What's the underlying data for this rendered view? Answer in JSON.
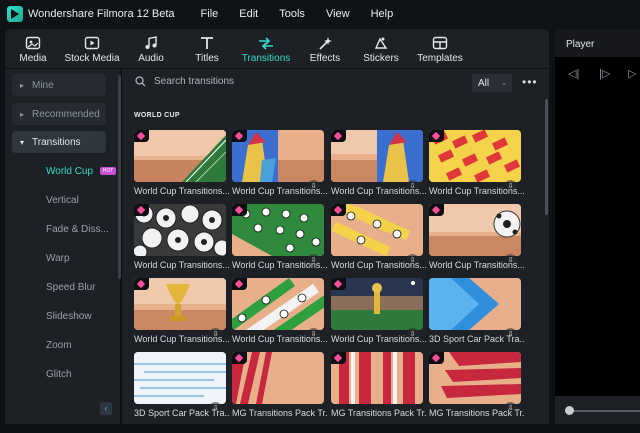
{
  "app": {
    "title": "Wondershare Filmora 12 Beta"
  },
  "menu": [
    "File",
    "Edit",
    "Tools",
    "View",
    "Help"
  ],
  "toolbar": [
    {
      "label": "Media",
      "icon": "media-icon"
    },
    {
      "label": "Stock Media",
      "icon": "stock-media-icon"
    },
    {
      "label": "Audio",
      "icon": "music-note-icon"
    },
    {
      "label": "Titles",
      "icon": "titles-icon"
    },
    {
      "label": "Transitions",
      "icon": "transitions-icon",
      "active": true
    },
    {
      "label": "Effects",
      "icon": "effects-icon"
    },
    {
      "label": "Stickers",
      "icon": "stickers-icon"
    },
    {
      "label": "Templates",
      "icon": "templates-icon"
    }
  ],
  "player": {
    "title": "Player"
  },
  "sidebar": {
    "groups": [
      {
        "label": "Mine",
        "expanded": false
      },
      {
        "label": "Recommended",
        "expanded": false
      },
      {
        "label": "Transitions",
        "expanded": true
      }
    ],
    "subitems": [
      "World Cup",
      "Vertical",
      "Fade & Diss...",
      "Warp",
      "Speed Blur",
      "Slideshow",
      "Zoom",
      "Glitch"
    ],
    "active_sub": "World Cup",
    "hot_badge": "HOT"
  },
  "search": {
    "placeholder": "Search transitions"
  },
  "filter": {
    "value": "All"
  },
  "section_title": "WORLD CUP",
  "items": [
    "World Cup Transitions...",
    "World Cup Transitions...",
    "World Cup Transitions...",
    "World Cup Transitions...",
    "World Cup Transitions...",
    "World Cup Transitions...",
    "World Cup Transitions...",
    "World Cup Transitions...",
    "World Cup Transitions...",
    "World Cup Transitions...",
    "World Cup Transitions...",
    "3D Sport Car Pack Tra...",
    "3D Sport Car Pack Tra...",
    "MG Transitions Pack Tr...",
    "MG Transitions Pack Tr...",
    "MG Transitions Pack Tr..."
  ],
  "colors": {
    "accent": "#38d9c7",
    "hot": "#c750d6",
    "premium_gem": "#ff4f9a"
  }
}
